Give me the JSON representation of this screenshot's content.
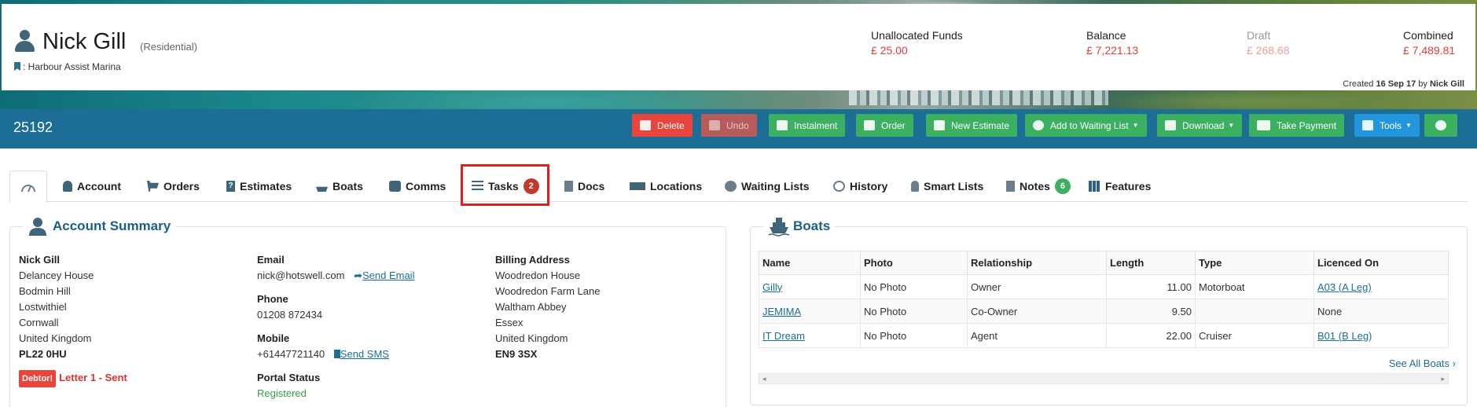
{
  "header": {
    "customer_name": "Nick Gill",
    "customer_type": "(Residential)",
    "marina": ": Harbour Assist Marina",
    "funds": [
      {
        "label": "Unallocated Funds",
        "value": "£ 25.00"
      },
      {
        "label": "Balance",
        "value": "£ 7,221.13"
      },
      {
        "label": "Draft",
        "value": "£ 268.68"
      },
      {
        "label": "Combined",
        "value": "£ 7,489.81"
      }
    ],
    "created_prefix": "Created ",
    "created_date": "16 Sep 17",
    "created_by_prefix": " by ",
    "created_by": "Nick Gill"
  },
  "action_bar": {
    "record_id": "25192",
    "buttons": {
      "delete": "Delete",
      "undo": "Undo",
      "instalment": "Instalment",
      "order": "Order",
      "new_estimate": "New Estimate",
      "add_waiting": "Add to Waiting List",
      "download": "Download",
      "take_payment": "Take Payment",
      "tools": "Tools"
    }
  },
  "tabs": {
    "account": "Account",
    "orders": "Orders",
    "estimates": "Estimates",
    "boats": "Boats",
    "comms": "Comms",
    "tasks": "Tasks",
    "tasks_count": "2",
    "docs": "Docs",
    "locations": "Locations",
    "waiting_lists": "Waiting Lists",
    "history": "History",
    "smart_lists": "Smart Lists",
    "notes": "Notes",
    "notes_count": "6",
    "features": "Features"
  },
  "account_summary": {
    "title": "Account Summary",
    "address": {
      "name": "Nick Gill",
      "line1": "Delancey House",
      "line2": "Bodmin Hill",
      "line3": "Lostwithiel",
      "line4": "Cornwall",
      "line5": "United Kingdom",
      "postcode": "PL22 0HU"
    },
    "debtor_badge": "Debtor!",
    "debtor_text": "Letter 1 - Sent",
    "email_label": "Email",
    "email": "nick@hotswell.com",
    "send_email": "Send Email",
    "phone_label": "Phone",
    "phone": "01208 872434",
    "mobile_label": "Mobile",
    "mobile": "+61447721140",
    "send_sms": "Send SMS",
    "portal_label": "Portal Status",
    "portal_status": "Registered",
    "billing": {
      "label": "Billing Address",
      "line1": "Woodredon House",
      "line2": "Woodredon Farm Lane",
      "line3": "Waltham Abbey",
      "line4": "Essex",
      "line5": "United Kingdom",
      "postcode": "EN9 3SX"
    }
  },
  "boats_panel": {
    "title": "Boats",
    "columns": [
      "Name",
      "Photo",
      "Relationship",
      "Length",
      "Type",
      "Licenced On"
    ],
    "rows": [
      {
        "name": "Gilly",
        "photo": "No Photo",
        "relationship": "Owner",
        "length": "11.00",
        "type": "Motorboat",
        "licenced": "A03 (A Leg)"
      },
      {
        "name": "JEMIMA",
        "photo": "No Photo",
        "relationship": "Co-Owner",
        "length": "9.50",
        "type": "",
        "licenced": "None"
      },
      {
        "name": "IT Dream",
        "photo": "No Photo",
        "relationship": "Agent",
        "length": "22.00",
        "type": "Cruiser",
        "licenced": "B01 (B Leg)"
      }
    ],
    "see_all": "See All Boats"
  }
}
